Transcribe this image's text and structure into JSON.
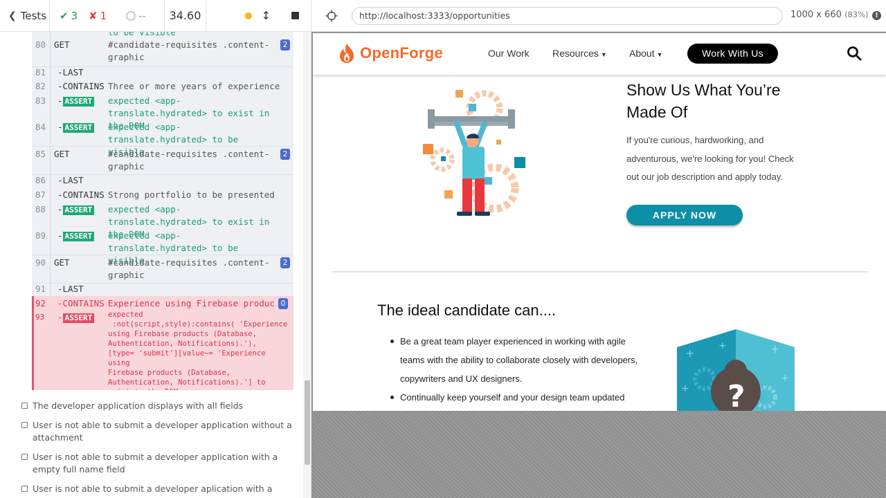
{
  "reporter": {
    "tests_label": "Tests",
    "passed": "3",
    "failed": "1",
    "pending": "--",
    "duration": "34.60",
    "cutoff_text": "to be visible",
    "commands": [
      {
        "num": "80",
        "name": "GET",
        "msg": "#candidate-requisites .content-graphic",
        "badge": "2"
      },
      {
        "num": "81",
        "name": "-LAST",
        "msg": ""
      },
      {
        "num": "82",
        "name": "-CONTAINS",
        "msg": "Three or more years of experience a…"
      },
      {
        "num": "83",
        "name": "-",
        "tag": "ASSERT",
        "msg": "expected <app-translate.hydrated> to exist in the DOM"
      },
      {
        "num": "84",
        "name": "-",
        "tag": "ASSERT",
        "msg": "expected <app-translate.hydrated> to be visible"
      },
      {
        "num": "85",
        "name": "GET",
        "msg": "#candidate-requisites .content-graphic",
        "badge": "2"
      },
      {
        "num": "86",
        "name": "-LAST",
        "msg": ""
      },
      {
        "num": "87",
        "name": "-CONTAINS",
        "msg": "Strong portfolio to be presented an…"
      },
      {
        "num": "88",
        "name": "-",
        "tag": "ASSERT",
        "msg": "expected <app-translate.hydrated> to exist in the DOM"
      },
      {
        "num": "89",
        "name": "-",
        "tag": "ASSERT",
        "msg": "expected <app-translate.hydrated> to be visible"
      },
      {
        "num": "90",
        "name": "GET",
        "msg": "#candidate-requisites .content-graphic",
        "badge": "2"
      },
      {
        "num": "91",
        "name": "-LAST",
        "msg": ""
      }
    ],
    "failed_command": {
      "num": "92",
      "name": "-CONTAINS",
      "msg": "Experience using Firebase produc…",
      "badge": "0"
    },
    "failed_assert": {
      "num": "93",
      "name": "-",
      "tag": "ASSERT",
      "error": "expected\n :not(script,style):contains( 'Experience\nusing Firebase products (Database,\nAuthentication, Notifications).'),\n[type= 'submit'][value~= 'Experience using\nFirebase products (Database,\nAuthentication, Notifications).'] to\nexist in the DOM"
    },
    "pending_tests": [
      "The developer application displays with all fields",
      "User is not able to submit a developer application without a attachment",
      "User is not able to submit a developer application with a empty full name field",
      "User is not able to submit a developer aplication with a"
    ]
  },
  "aut": {
    "url": "http://localhost:3333/opportunities",
    "viewport": "1000 x 660",
    "zoom": "(83%)"
  },
  "site": {
    "logo": "OpenForge",
    "nav": [
      "Our Work",
      "Resources",
      "About"
    ],
    "nav_cta": "Work With Us",
    "hero_title": "Show Us What You’re Made Of",
    "hero_text": "If you're curious, hardworking, and adventurous, we're looking for you! Check out our job description and apply today.",
    "apply_button": "APPLY NOW",
    "candidate_title": "The ideal candidate can....",
    "bullets": [
      "Be a great team player experienced in working with agile teams with the ability to collaborate closely with developers, copywriters and UX designers.",
      "Continually keep yourself and your design team updated"
    ]
  },
  "colors": {
    "pass": "#2a9d5c",
    "fail": "#e03b3b",
    "brand_orange": "#f26b2a",
    "apply_teal": "#0e8fa8"
  }
}
